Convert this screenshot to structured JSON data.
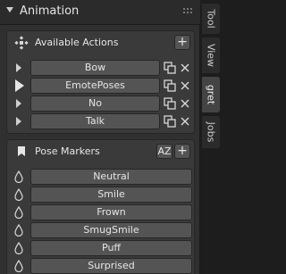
{
  "panel": {
    "title": "Animation"
  },
  "actions": {
    "title": "Available Actions",
    "add_label": "+",
    "items": [
      {
        "label": "Bow",
        "playing": false
      },
      {
        "label": "EmotePoses",
        "playing": true
      },
      {
        "label": "No",
        "playing": false
      },
      {
        "label": "Talk",
        "playing": false
      }
    ]
  },
  "markers": {
    "title": "Pose Markers",
    "sort_label": "AZ",
    "add_label": "+",
    "items": [
      {
        "label": "Neutral"
      },
      {
        "label": "Smile"
      },
      {
        "label": "Frown"
      },
      {
        "label": "SmugSmile"
      },
      {
        "label": "Puff"
      },
      {
        "label": "Surprised"
      }
    ]
  },
  "tabs": [
    {
      "label": "Tool",
      "active": false
    },
    {
      "label": "View",
      "active": false
    },
    {
      "label": "gret",
      "active": true
    },
    {
      "label": "Jobs",
      "active": false
    }
  ],
  "colors": {
    "panel": "#303030",
    "subpanel": "#3a3a3a",
    "field": "#545454",
    "text": "#e6e6e6"
  }
}
